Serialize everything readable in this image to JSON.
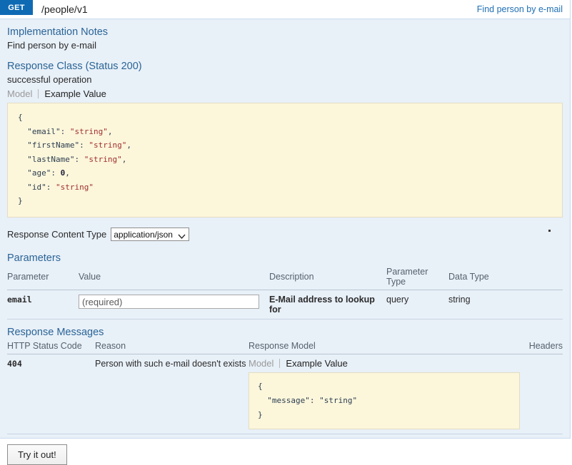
{
  "operation": {
    "method": "GET",
    "path": "/people/v1",
    "summary": "Find person by e-mail"
  },
  "implementation_notes": {
    "title": "Implementation Notes",
    "text": "Find person by e-mail"
  },
  "response_class": {
    "title": "Response Class (Status 200)",
    "description": "successful operation",
    "tabs": {
      "model": "Model",
      "example_value": "Example Value"
    },
    "example_value": {
      "open_brace": "{",
      "close_brace": "}",
      "lines": [
        {
          "key": "\"email\"",
          "sep": ": ",
          "value": "\"string\"",
          "type": "str",
          "comma": ","
        },
        {
          "key": "\"firstName\"",
          "sep": ": ",
          "value": "\"string\"",
          "type": "str",
          "comma": ","
        },
        {
          "key": "\"lastName\"",
          "sep": ": ",
          "value": "\"string\"",
          "type": "str",
          "comma": ","
        },
        {
          "key": "\"age\"",
          "sep": ": ",
          "value": "0",
          "type": "num",
          "comma": ","
        },
        {
          "key": "\"id\"",
          "sep": ": ",
          "value": "\"string\"",
          "type": "str",
          "comma": ""
        }
      ]
    }
  },
  "content_type": {
    "label": "Response Content Type",
    "selected": "application/json",
    "options": [
      "application/json"
    ]
  },
  "parameters": {
    "title": "Parameters",
    "columns": [
      "Parameter",
      "Value",
      "Description",
      "Parameter Type",
      "Data Type"
    ],
    "rows": [
      {
        "name": "email",
        "value": "",
        "placeholder": "(required)",
        "description": "E-Mail address to lookup for",
        "param_type": "query",
        "data_type": "string"
      }
    ]
  },
  "response_messages": {
    "title": "Response Messages",
    "columns": [
      "HTTP Status Code",
      "Reason",
      "Response Model",
      "Headers"
    ],
    "rows": [
      {
        "status_code": "404",
        "reason": "Person with such e-mail doesn't exists",
        "tabs": {
          "model": "Model",
          "example_value": "Example Value"
        },
        "example_value": {
          "open_brace": "{",
          "close_brace": "}",
          "lines": [
            {
              "key": "\"message\"",
              "sep": ": ",
              "value": "\"string\"",
              "type": "str",
              "comma": ""
            }
          ]
        },
        "headers": ""
      }
    ]
  },
  "submit": {
    "label": "Try it out!"
  },
  "colors": {
    "method_badge": "#0f6ab4",
    "panel_background": "#e8f0f8",
    "snippet_background": "#fcf6db",
    "heading_link": "#2a6496",
    "string_literal": "#a0302e"
  }
}
